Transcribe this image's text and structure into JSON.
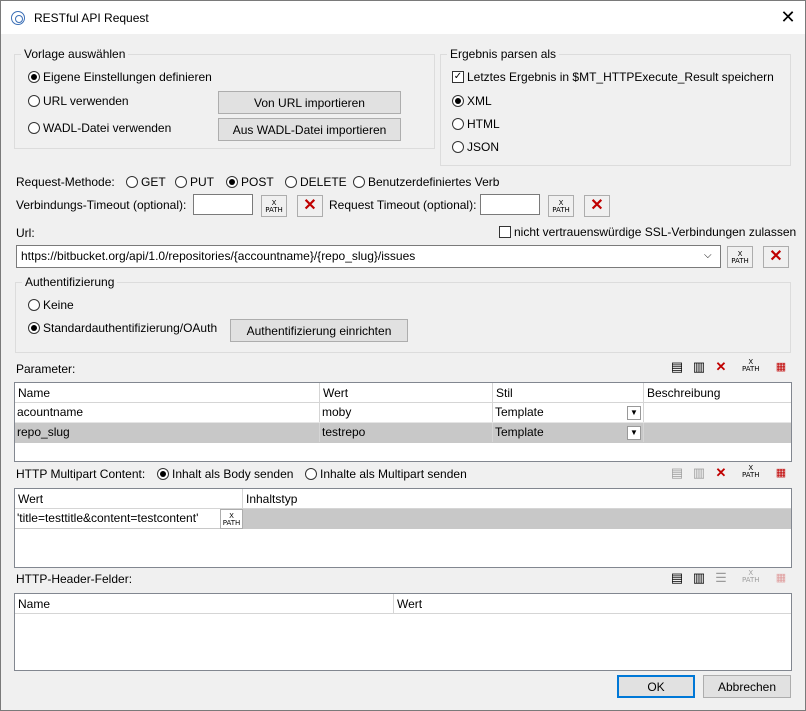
{
  "window": {
    "title": "RESTful API Request"
  },
  "vorlage": {
    "group_label": "Vorlage auswählen",
    "options": [
      "Eigene Einstellungen definieren",
      "URL verwenden",
      "WADL-Datei verwenden"
    ],
    "selected": 0,
    "btn_url": "Von URL importieren",
    "btn_wadl": "Aus WADL-Datei importieren"
  },
  "ergebnis": {
    "group_label": "Ergebnis parsen als",
    "save_checkbox": "Letztes Ergebnis in $MT_HTTPExecute_Result speichern",
    "save_checked": true,
    "formats": [
      "XML",
      "HTML",
      "JSON"
    ],
    "selected": 0
  },
  "request": {
    "method_label": "Request-Methode:",
    "methods": [
      "GET",
      "PUT",
      "POST",
      "DELETE",
      "Benutzerdefiniertes Verb"
    ],
    "selected": 2,
    "conn_timeout_label": "Verbindungs-Timeout (optional):",
    "conn_timeout_value": "",
    "req_timeout_label": "Request Timeout (optional):",
    "req_timeout_value": "",
    "url_label": "Url:",
    "ssl_checkbox": "nicht vertrauenswürdige SSL-Verbindungen zulassen",
    "ssl_checked": false,
    "url_value": "https://bitbucket.org/api/1.0/repositories/{accountname}/{repo_slug}/issues"
  },
  "auth": {
    "group_label": "Authentifizierung",
    "options": [
      "Keine",
      "Standardauthentifizierung/OAuth"
    ],
    "selected": 1,
    "setup_button": "Authentifizierung einrichten"
  },
  "parameter": {
    "label": "Parameter:",
    "columns": [
      "Name",
      "Wert",
      "Stil",
      "Beschreibung"
    ],
    "rows": [
      {
        "name": "acountname",
        "wert": "moby",
        "stil": "Template",
        "beschreibung": ""
      },
      {
        "name": "repo_slug",
        "wert": "testrepo",
        "stil": "Template",
        "beschreibung": ""
      }
    ]
  },
  "multipart": {
    "label": "HTTP Multipart Content:",
    "options": [
      "Inhalt als Body senden",
      "Inhalte als Multipart senden"
    ],
    "selected": 0,
    "columns": [
      "Wert",
      "Inhaltstyp"
    ],
    "rows": [
      {
        "wert": "'title=testtitle&content=testcontent'",
        "inhaltstyp": ""
      }
    ]
  },
  "header": {
    "label": "HTTP-Header-Felder:",
    "columns": [
      "Name",
      "Wert"
    ]
  },
  "xpath_text": {
    "line1": "X",
    "line2": "PATH"
  },
  "footer": {
    "ok": "OK",
    "cancel": "Abbrechen"
  }
}
